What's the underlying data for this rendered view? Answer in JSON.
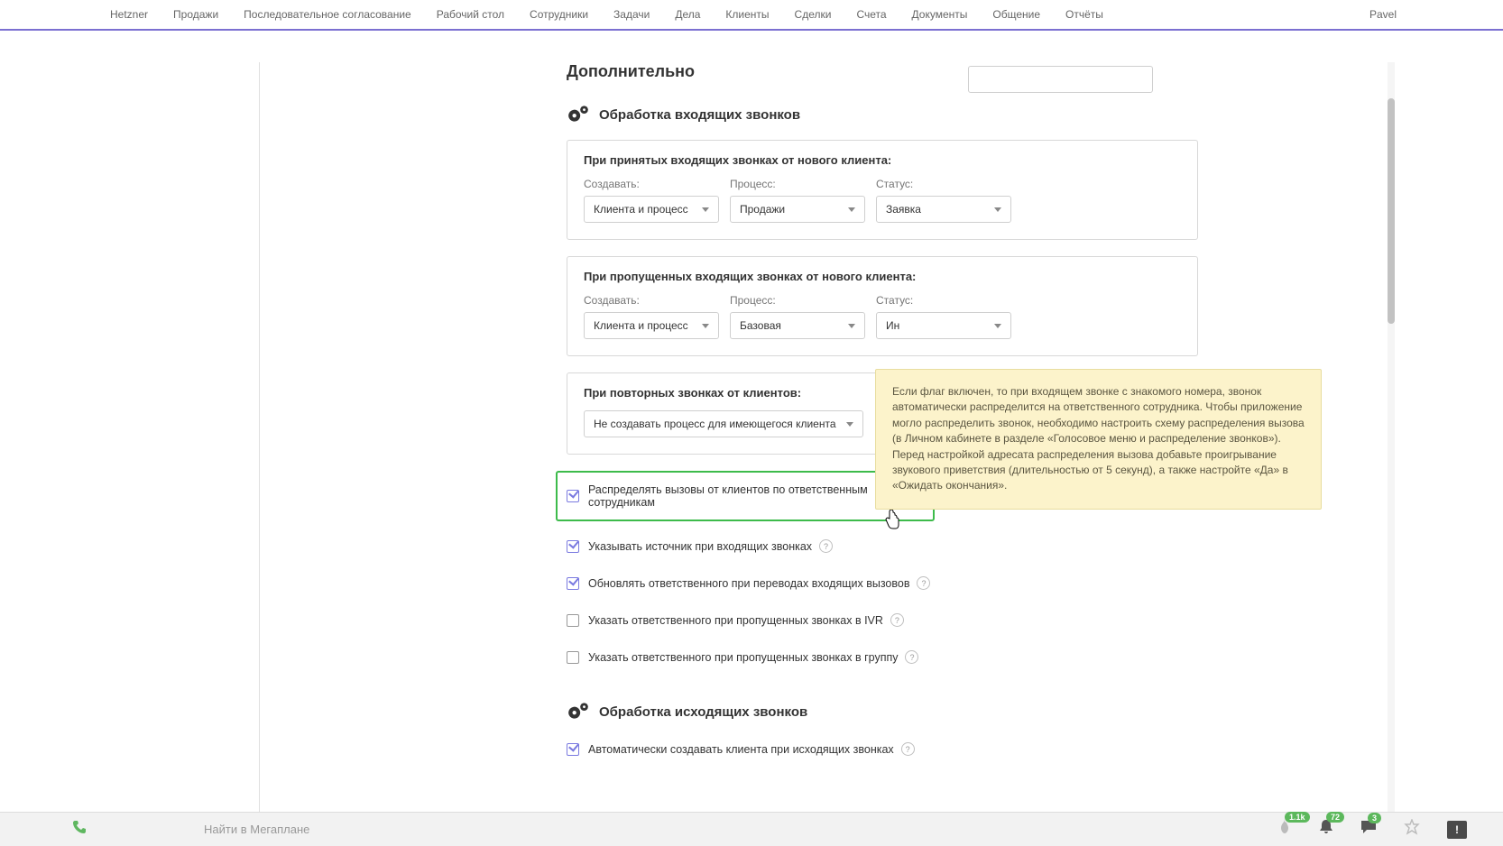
{
  "nav": {
    "items": [
      "Hetzner",
      "Продажи",
      "Последовательное согласование",
      "Рабочий стол",
      "Сотрудники",
      "Задачи",
      "Дела",
      "Клиенты",
      "Сделки",
      "Счета",
      "Документы",
      "Общение",
      "Отчёты"
    ],
    "user": "Pavel"
  },
  "section": {
    "title": "Дополнительно"
  },
  "incoming": {
    "heading": "Обработка входящих звонков",
    "panel1": {
      "title": "При принятых входящих звонках от нового клиента:",
      "create_label": "Создавать:",
      "create_value": "Клиента и процесс",
      "process_label": "Процесс:",
      "process_value": "Продажи",
      "status_label": "Статус:",
      "status_value": "Заявка"
    },
    "panel2": {
      "title": "При пропущенных входящих звонках от нового клиента:",
      "create_label": "Создавать:",
      "create_value": "Клиента и процесс",
      "process_label": "Процесс:",
      "process_value": "Базовая",
      "status_label": "Статус:",
      "status_value": "Ин"
    },
    "panel3": {
      "title": "При повторных звонках от клиентов:",
      "option_value": "Не создавать процесс для имеющегося клиента"
    }
  },
  "checks": {
    "c1": "Распределять вызовы от клиентов по ответственным сотрудникам",
    "c2": "Указывать источник при входящих звонках",
    "c3": "Обновлять ответственного при переводах входящих вызовов",
    "c4": "Указать ответственного при пропущенных звонках в IVR",
    "c5": "Указать ответственного при пропущенных звонках в группу"
  },
  "outgoing": {
    "heading": "Обработка исходящих звонков",
    "c1": "Автоматически создавать клиента при исходящих звонках"
  },
  "tooltip": {
    "text": "Если флаг включен, то при входящем звонке с знакомого номера, звонок автоматически распределится на ответственного сотрудника. Чтобы приложение могло распределить звонок, необходимо настроить схему распределения вызова (в Личном кабинете в разделе «Голосовое меню и распределение звонков»). Перед настройкой адресата распределения вызова добавьте проигрывание звукового приветствия (длительностью от 5 секунд), а также настройте «Да» в «Ожидать окончания»."
  },
  "bottom": {
    "search_placeholder": "Найти в Мегаплане",
    "badge1": "1.1k",
    "badge2": "72",
    "badge3": "3"
  },
  "help_q": "?"
}
